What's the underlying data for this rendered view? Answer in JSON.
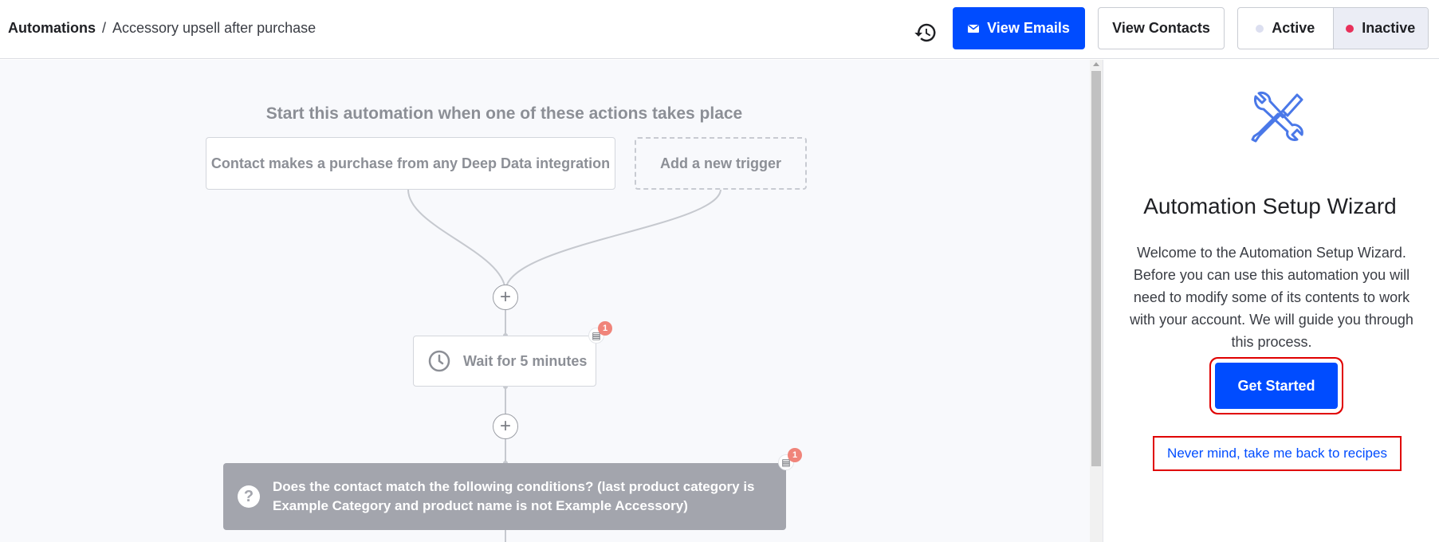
{
  "breadcrumb": {
    "root": "Automations",
    "separator": "/",
    "current": "Accessory upsell after purchase"
  },
  "header": {
    "history_icon": "history-icon",
    "view_emails": {
      "label": "View Emails",
      "icon": "mail-icon"
    },
    "view_contacts": {
      "label": "View Contacts"
    },
    "status_toggle": {
      "active_label": "Active",
      "inactive_label": "Inactive",
      "selected": "Inactive"
    }
  },
  "canvas": {
    "title": "Start this automation when one of these actions takes place",
    "triggers": [
      {
        "label": "Contact makes a purchase from any Deep Data integration"
      },
      {
        "label": "Add a new trigger"
      }
    ],
    "steps": {
      "wait": {
        "label": "Wait for 5 minutes",
        "note_count": "1"
      },
      "condition": {
        "label": "Does the contact match the following conditions? (last product category is Example Category and product name is not Example Accessory)",
        "icon": "?",
        "note_count": "1"
      }
    },
    "add_step_symbol": "+"
  },
  "wizard": {
    "icon": "tools-icon",
    "title": "Automation Setup Wizard",
    "description": "Welcome to the Automation Setup Wizard. Before you can use this automation you will need to modify some of its contents to work with your account. We will guide you through this process.",
    "primary_button": "Get Started",
    "secondary_link": "Never mind, take me back to recipes"
  },
  "colors": {
    "primary": "#004cff",
    "inactive_dot": "#e8305a",
    "highlight": "#e00000",
    "condition_bg": "#a3a5ad"
  }
}
